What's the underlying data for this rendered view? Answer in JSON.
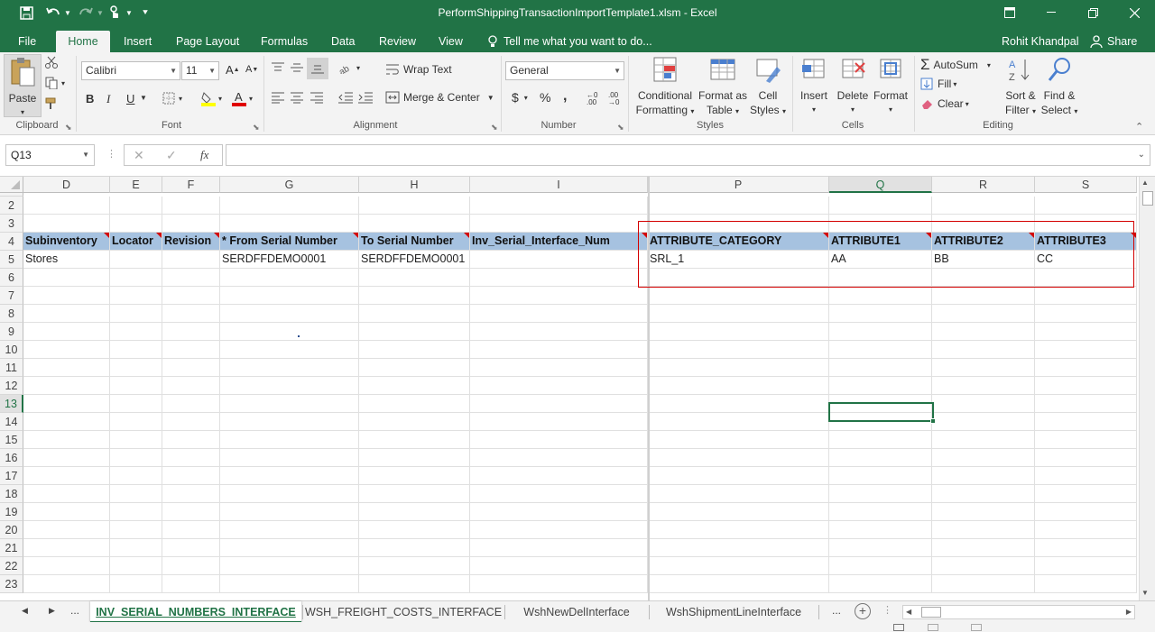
{
  "window": {
    "title": "PerformShippingTransactionImportTemplate1.xlsm - Excel",
    "user": "Rohit Khandpal",
    "share": "Share"
  },
  "ribbon_tabs": [
    "File",
    "Home",
    "Insert",
    "Page Layout",
    "Formulas",
    "Data",
    "Review",
    "View"
  ],
  "tell_me": "Tell me what you want to do...",
  "clipboard": {
    "paste": "Paste",
    "group": "Clipboard"
  },
  "font": {
    "name": "Calibri",
    "size": "11",
    "group": "Font",
    "bold": "B",
    "italic": "I",
    "underline": "U"
  },
  "alignment": {
    "wrap": "Wrap Text",
    "merge": "Merge & Center",
    "group": "Alignment"
  },
  "number": {
    "format": "General",
    "group": "Number",
    "currency": "$",
    "percent": "%",
    "comma": ","
  },
  "styles": {
    "conditional": "Conditional",
    "conditional2": "Formatting",
    "format_as": "Format as",
    "format_as2": "Table",
    "cell": "Cell",
    "cell2": "Styles",
    "group": "Styles"
  },
  "cells": {
    "insert": "Insert",
    "delete": "Delete",
    "format": "Format",
    "group": "Cells"
  },
  "editing": {
    "autosum": "AutoSum",
    "fill": "Fill",
    "clear": "Clear",
    "sort": "Sort &",
    "sort2": "Filter",
    "find": "Find &",
    "find2": "Select",
    "group": "Editing"
  },
  "formula_bar": {
    "name_box": "Q13",
    "fx": "fx",
    "value": ""
  },
  "columns": [
    {
      "id": "D",
      "label": "D"
    },
    {
      "id": "E",
      "label": "E"
    },
    {
      "id": "F",
      "label": "F"
    },
    {
      "id": "G",
      "label": "G"
    },
    {
      "id": "H",
      "label": "H"
    },
    {
      "id": "I",
      "label": "I"
    },
    {
      "id": "P",
      "label": "P"
    },
    {
      "id": "Q",
      "label": "Q"
    },
    {
      "id": "R",
      "label": "R"
    },
    {
      "id": "S",
      "label": "S"
    }
  ],
  "rows": [
    "2",
    "3",
    "4",
    "5",
    "6",
    "7",
    "8",
    "9",
    "10",
    "11",
    "12",
    "13",
    "14",
    "15",
    "16",
    "17",
    "18",
    "19",
    "20",
    "21",
    "22",
    "23"
  ],
  "header_row": [
    "Subinventory",
    "Locator",
    "Revision",
    "* From Serial Number",
    "To Serial Number",
    "Inv_Serial_Interface_Num",
    "ATTRIBUTE_CATEGORY",
    "ATTRIBUTE1",
    "ATTRIBUTE2",
    "ATTRIBUTE3"
  ],
  "data_row": [
    "Stores",
    "",
    "",
    "SERDFFDEMO0001",
    "SERDFFDEMO0001",
    "",
    "SRL_1",
    "AA",
    "BB",
    "CC"
  ],
  "sheet_tabs": [
    "INV_SERIAL_NUMBERS_INTERFACE",
    "WSH_FREIGHT_COSTS_INTERFACE",
    "WshNewDelInterface",
    "WshShipmentLineInterface"
  ],
  "more_tabs": "...",
  "colors": {
    "excel_green": "#217346",
    "header_fill": "#a6c2e0",
    "highlight_box": "#d40000"
  }
}
